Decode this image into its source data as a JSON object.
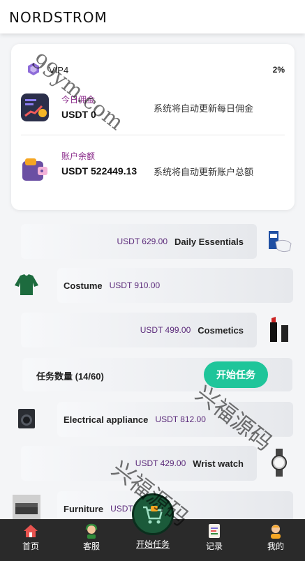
{
  "header": {
    "logo": "NORDSTROM"
  },
  "vip": {
    "level": "VIP4",
    "percent": "2%"
  },
  "stats": [
    {
      "title": "今日佣金",
      "value": "USDT 0",
      "note": "系统将自动更新每日佣金",
      "icon": "commission-chart-icon"
    },
    {
      "title": "账户余额",
      "value": "USDT 522449.13",
      "note": "系统将自动更新账户总额",
      "icon": "wallet-icon"
    }
  ],
  "products": [
    {
      "price": "USDT 629.00",
      "name": "Daily Essentials",
      "icon": "mask-box-icon"
    },
    {
      "price": "USDT 910.00",
      "name": "Costume",
      "icon": "sweater-icon"
    },
    {
      "price": "USDT 499.00",
      "name": "Cosmetics",
      "icon": "lipstick-icon"
    },
    {
      "price": "USDT 812.00",
      "name": "Electrical appliance",
      "icon": "washing-machine-icon"
    },
    {
      "price": "USDT 429.00",
      "name": "Wrist watch",
      "icon": "watch-icon"
    },
    {
      "price": "USDT",
      "name": "Furniture",
      "icon": "sofa-icon"
    }
  ],
  "task": {
    "label": "任务数量 (14/60)",
    "button": "开始任务"
  },
  "tabs": [
    {
      "label": "首页",
      "icon": "home-icon"
    },
    {
      "label": "客服",
      "icon": "support-icon"
    },
    {
      "label": "开始任务",
      "icon": "cart-icon"
    },
    {
      "label": "记录",
      "icon": "records-icon"
    },
    {
      "label": "我的",
      "icon": "profile-icon"
    }
  ],
  "watermarks": {
    "domain": "99ym.com",
    "brand": "兴福源码"
  },
  "colors": {
    "accent": "#1fc59a",
    "price": "#5b2a7a",
    "tabbar": "#2a2a2a"
  }
}
